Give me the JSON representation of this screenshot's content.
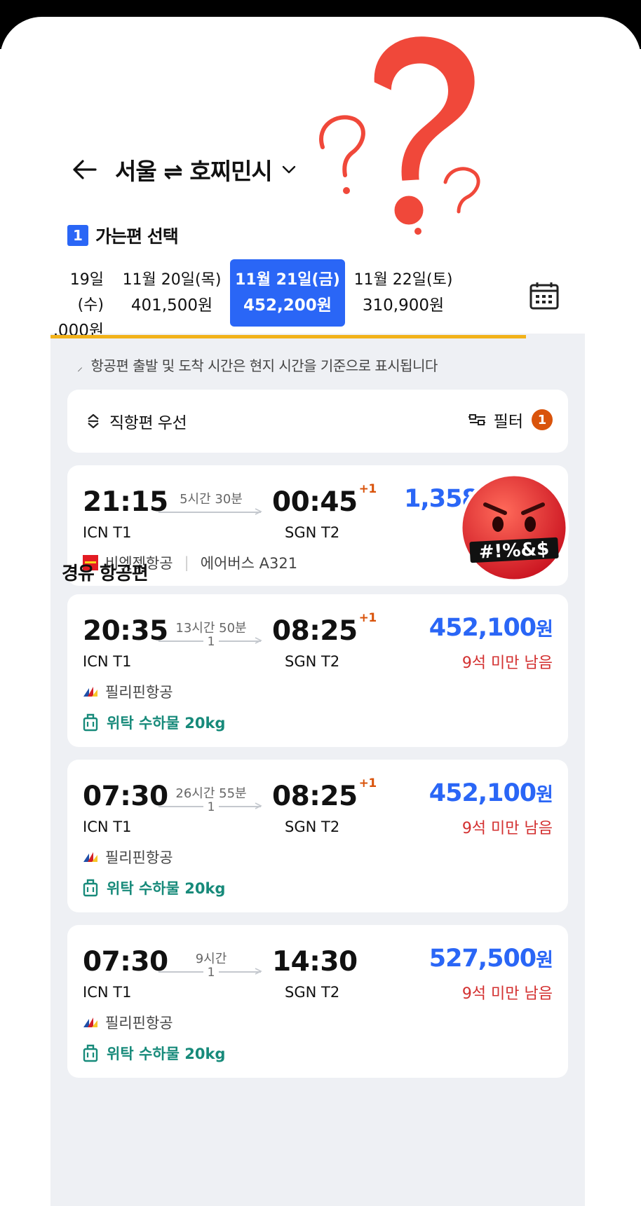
{
  "header": {
    "route_title": "서울 ⇌ 호찌민시"
  },
  "step": {
    "number": "1",
    "label": "가는편 선택"
  },
  "date_tabs": [
    {
      "date": "19일(수)",
      "price": ",000원"
    },
    {
      "date": "11월 20일(목)",
      "price": "401,500원"
    },
    {
      "date": "11월 21일(금)",
      "price": "452,200원"
    },
    {
      "date": "11월 22일(토)",
      "price": "310,900원"
    }
  ],
  "notice": "항공편 출발 및 도착 시간은 현지 시간을 기준으로 표시됩니다",
  "sort": {
    "label": "직항편 우선",
    "filter_label": "필터",
    "filter_count": "1"
  },
  "direct_flight": {
    "dep_time": "21:15",
    "dep_airport": "ICN T1",
    "arr_time": "00:45",
    "arr_plus": "+1",
    "arr_airport": "SGN T2",
    "duration": "5시간 30분",
    "price": "1,358,100",
    "currency": "원",
    "airline": "비엣젯항공",
    "aircraft": "에어버스 A321"
  },
  "layover_title": "경유 항공편",
  "layover_flights": [
    {
      "dep_time": "20:35",
      "dep_airport": "ICN T1",
      "arr_time": "08:25",
      "arr_plus": "+1",
      "arr_airport": "SGN T2",
      "duration": "13시간 50분",
      "stops": "1",
      "price": "452,100",
      "currency": "원",
      "seats": "9석 미만 남음",
      "airline": "필리핀항공",
      "baggage": "위탁 수하물 20kg"
    },
    {
      "dep_time": "07:30",
      "dep_airport": "ICN T1",
      "arr_time": "08:25",
      "arr_plus": "+1",
      "arr_airport": "SGN T2",
      "duration": "26시간 55분",
      "stops": "1",
      "price": "452,100",
      "currency": "원",
      "seats": "9석 미만 남음",
      "airline": "필리핀항공",
      "baggage": "위탁 수하물 20kg"
    },
    {
      "dep_time": "07:30",
      "dep_airport": "ICN T1",
      "arr_time": "14:30",
      "arr_plus": "",
      "arr_airport": "SGN T2",
      "duration": "9시간",
      "stops": "1",
      "price": "527,500",
      "currency": "원",
      "seats": "9석 미만 남음",
      "airline": "필리핀항공",
      "baggage": "위탁 수하물 20kg"
    }
  ],
  "sticker_text": "#!%&$",
  "colors": {
    "accent": "#2a66f6",
    "price": "#2a66f6",
    "warning": "#d33030",
    "baggage": "#178a7a",
    "highlight": "#f2b21a"
  },
  "icons": [
    "back-arrow-icon",
    "chevron-down-icon",
    "calendar-icon",
    "sort-icon",
    "filter-icon",
    "airline-logo-icon",
    "luggage-icon"
  ]
}
